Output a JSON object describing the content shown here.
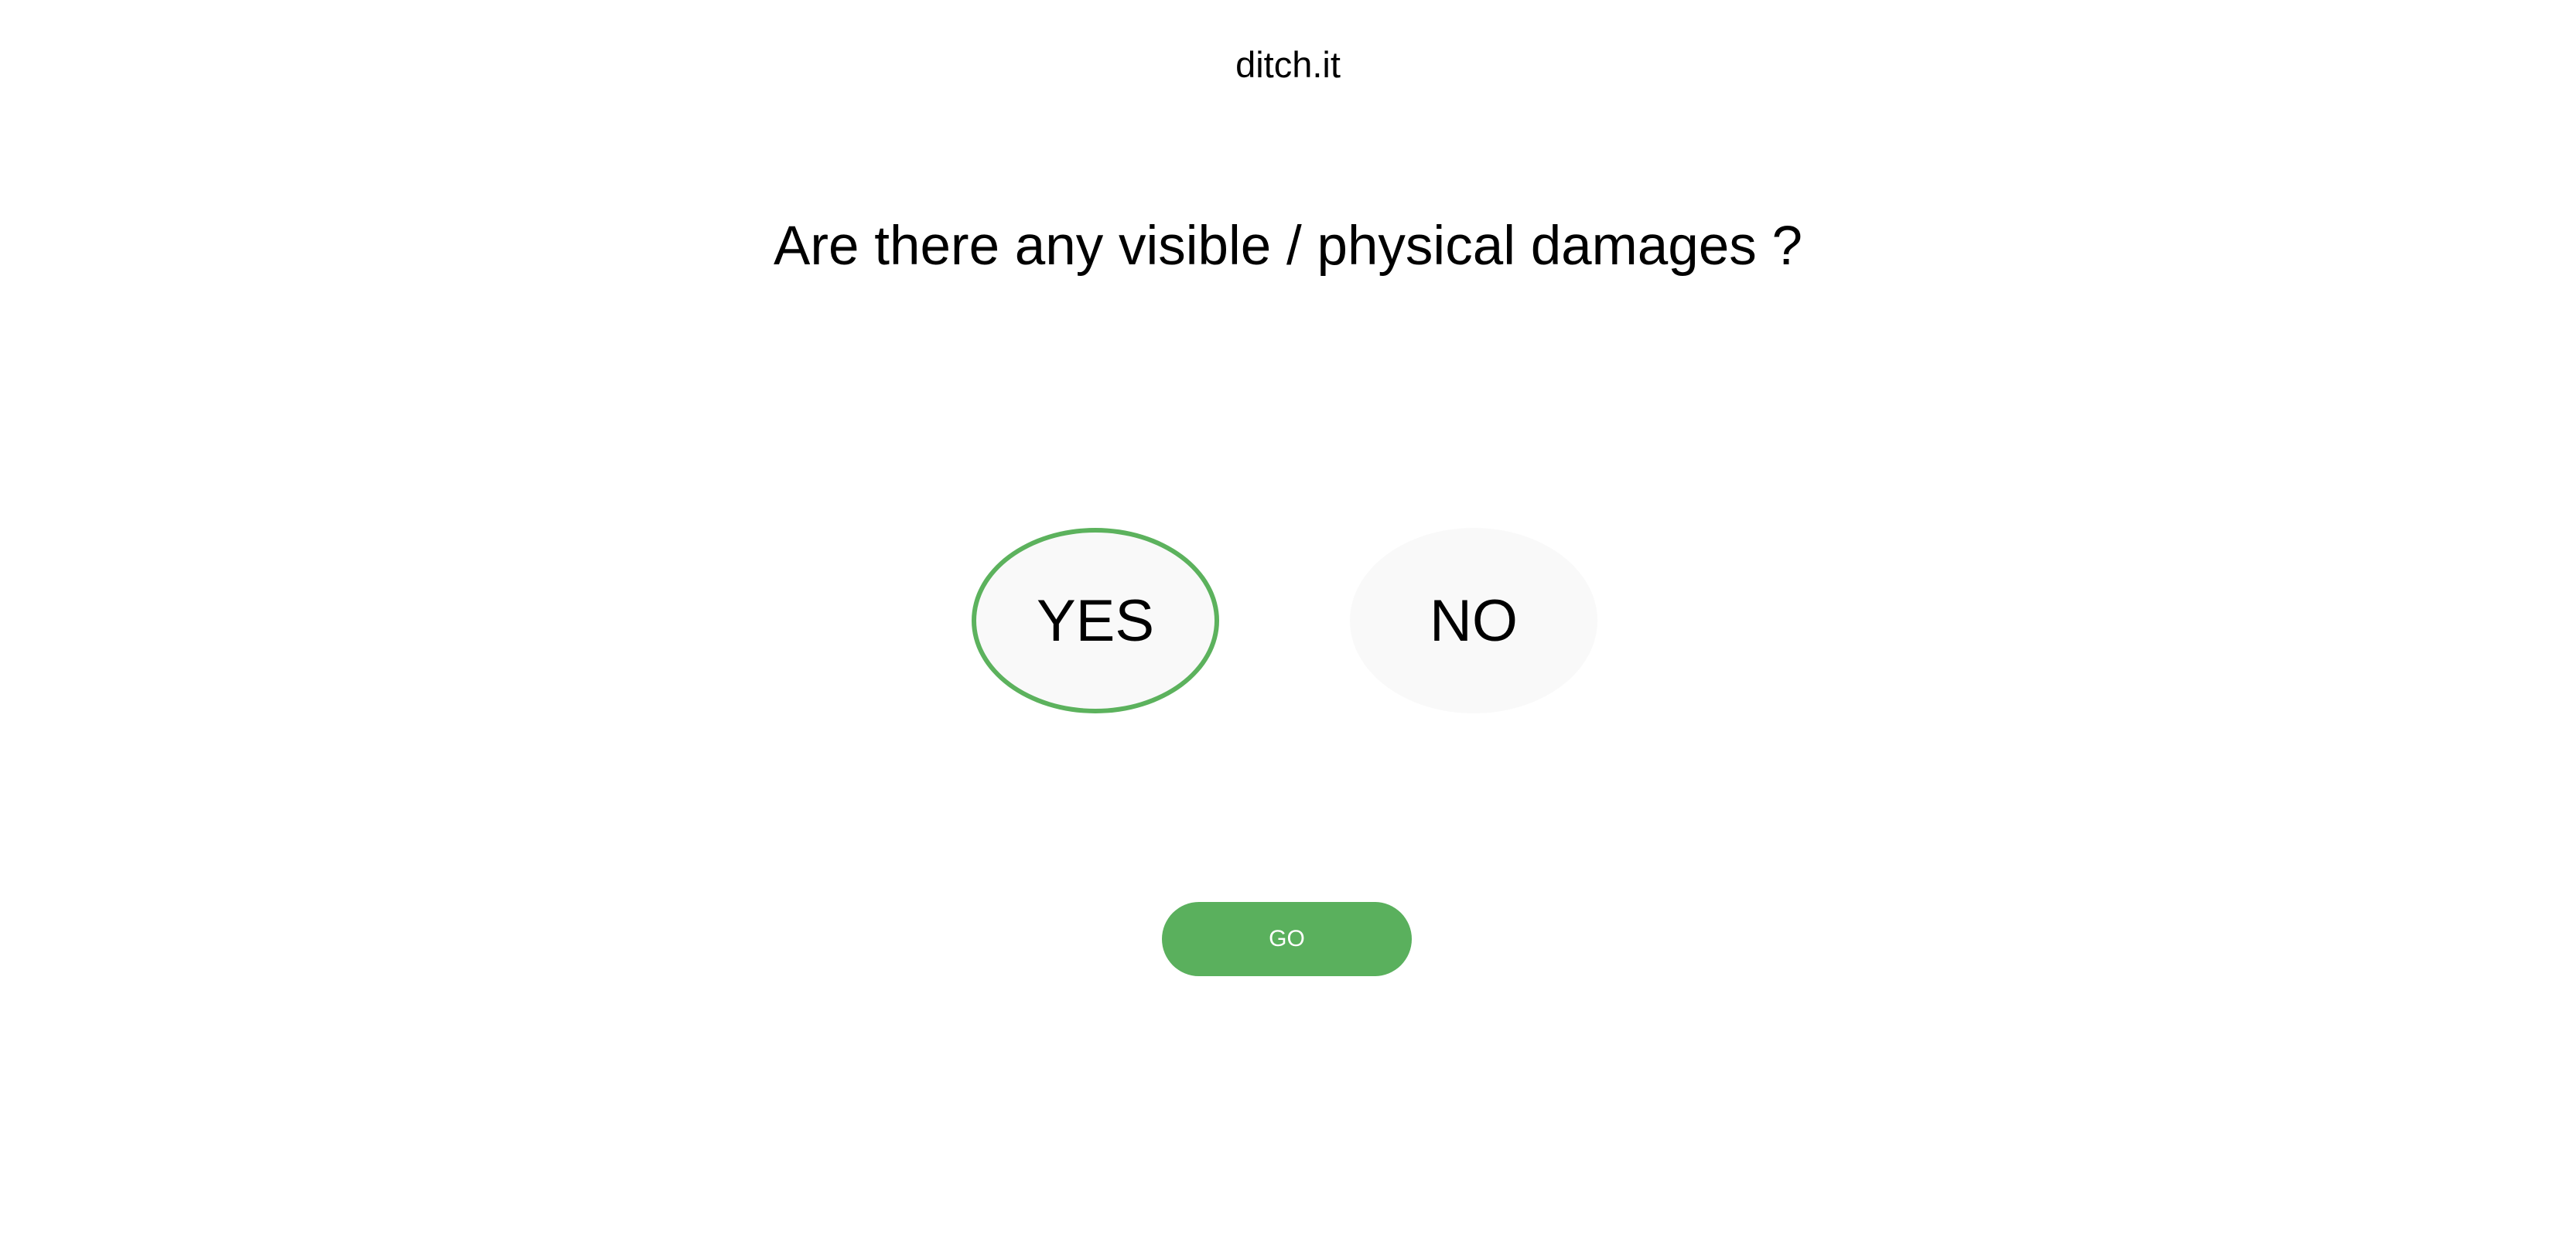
{
  "header": {
    "brand": "ditch.it"
  },
  "question": "Are there any visible / physical damages ?",
  "options": [
    {
      "label": "YES",
      "selected": true
    },
    {
      "label": "NO",
      "selected": false
    }
  ],
  "submit_label": "GO",
  "colors": {
    "accent": "#5ab05d",
    "option_bg": "#f9f9f9"
  }
}
